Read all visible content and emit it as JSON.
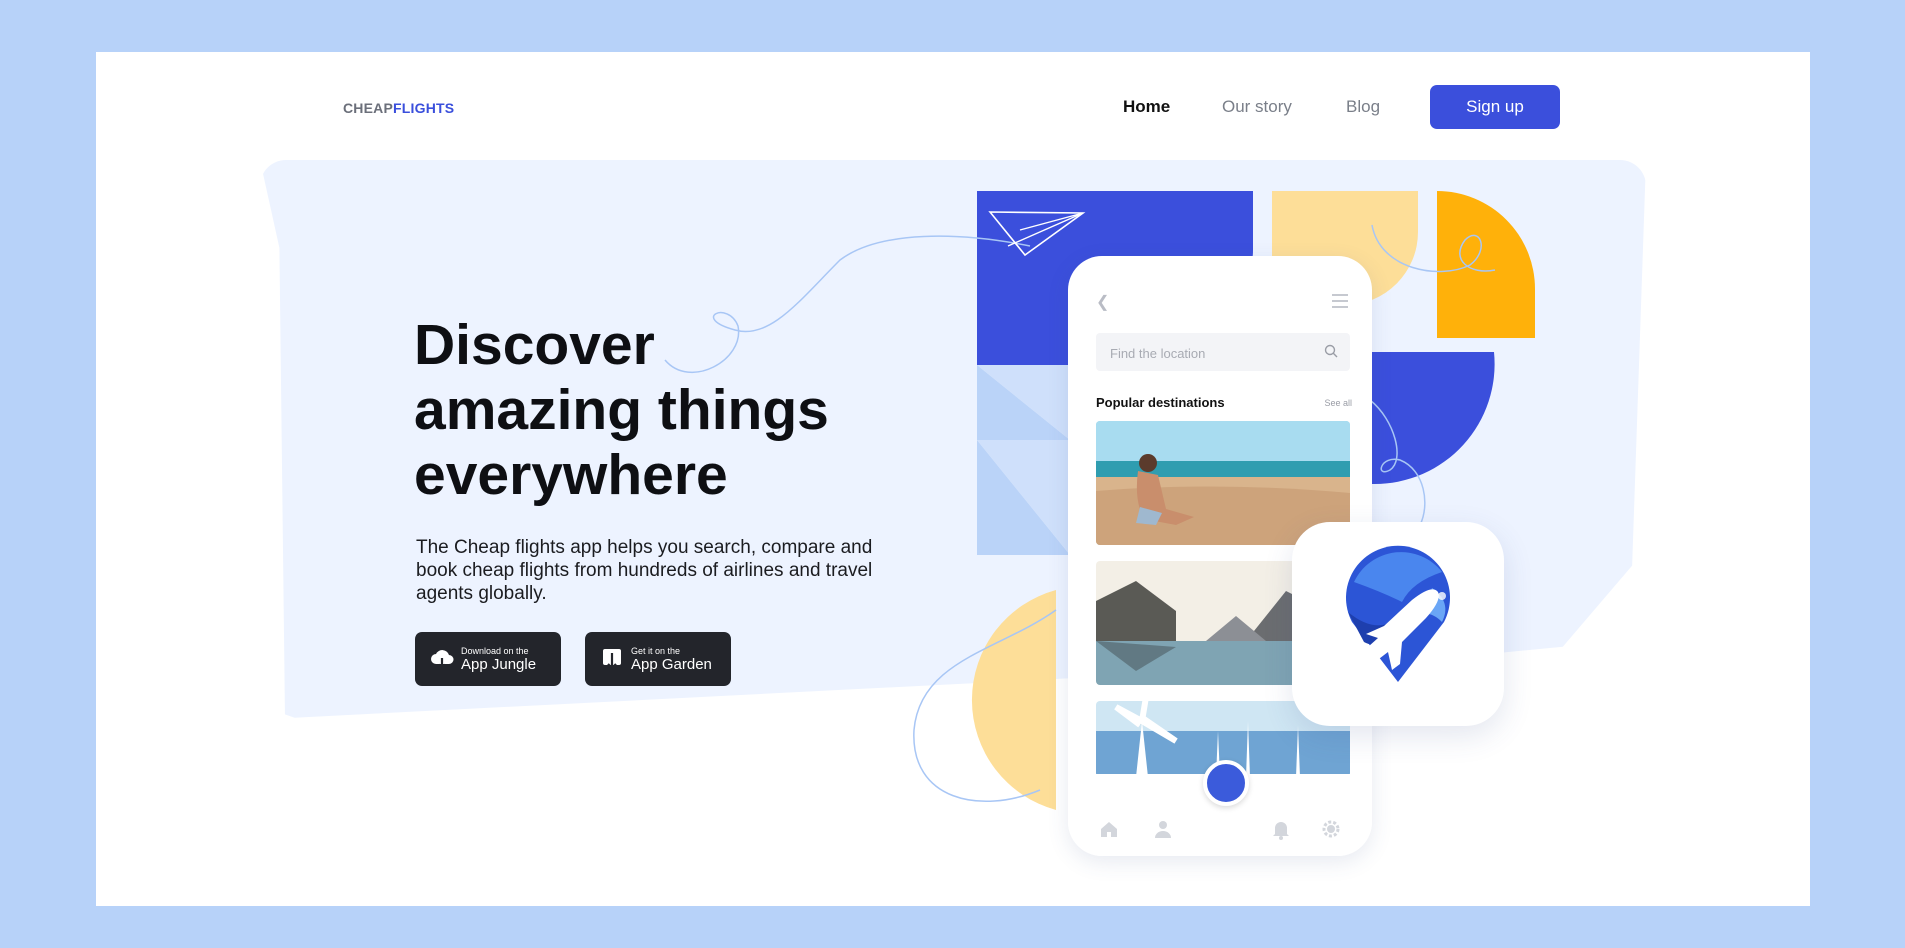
{
  "header": {
    "logo_part1": "CHEAP",
    "logo_part2": "FLIGHTS",
    "nav": [
      "Home",
      "Our story",
      "Blog"
    ],
    "signup_label": "Sign up"
  },
  "hero": {
    "headline": [
      "Discover",
      "amazing things",
      "everywhere"
    ],
    "description": "The Cheap flights app helps you search, compare and book cheap flights from hundreds of airlines and travel agents globally.",
    "store_buttons": [
      {
        "small": "Download on the",
        "big": "App Jungle"
      },
      {
        "small": "Get it on the",
        "big": "App Garden"
      }
    ]
  },
  "phone": {
    "search_placeholder": "Find the location",
    "section_title": "Popular destinations",
    "see_all": "See all"
  },
  "colors": {
    "brand_blue": "#3b4fdc",
    "pale_yellow": "#fdde98",
    "orange": "#ffb10a",
    "panel_bg": "#edf3ff",
    "outer_bg": "#b7d2f9"
  },
  "icons": [
    "paper-plane-icon",
    "back-chevron-icon",
    "menu-icon",
    "search-icon",
    "home-icon",
    "user-icon",
    "bell-icon",
    "gear-icon",
    "cloud-download-icon",
    "download-box-icon",
    "plane-pin-app-icon"
  ]
}
